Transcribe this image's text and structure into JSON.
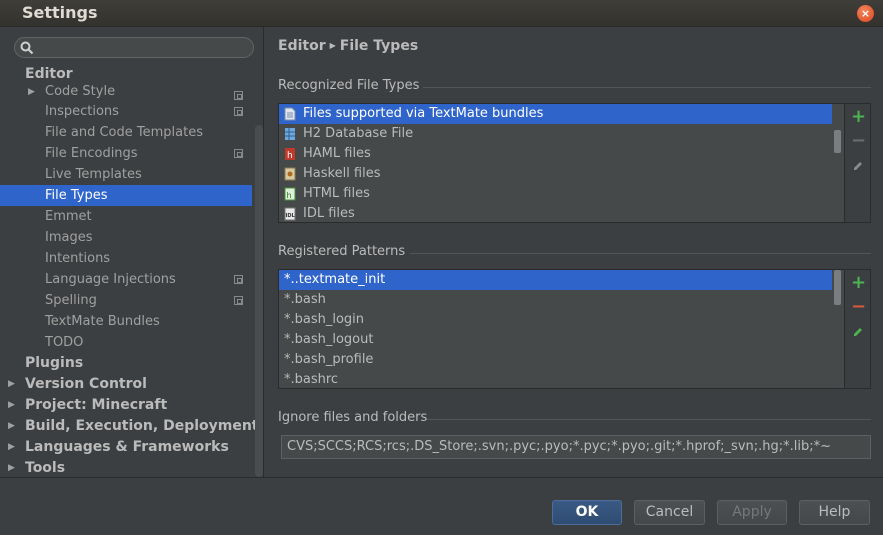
{
  "window": {
    "title": "Settings"
  },
  "sidebar": {
    "search": {
      "value": "",
      "placeholder": ""
    },
    "items": [
      {
        "label": "Editor",
        "kind": "category"
      },
      {
        "label": "Code Style",
        "kind": "sub",
        "expander": true,
        "scope": true
      },
      {
        "label": "Inspections",
        "kind": "sub",
        "scope": true
      },
      {
        "label": "File and Code Templates",
        "kind": "sub"
      },
      {
        "label": "File Encodings",
        "kind": "sub",
        "scope": true
      },
      {
        "label": "Live Templates",
        "kind": "sub"
      },
      {
        "label": "File Types",
        "kind": "sub",
        "selected": true
      },
      {
        "label": "Emmet",
        "kind": "sub"
      },
      {
        "label": "Images",
        "kind": "sub"
      },
      {
        "label": "Intentions",
        "kind": "sub"
      },
      {
        "label": "Language Injections",
        "kind": "sub",
        "scope": true
      },
      {
        "label": "Spelling",
        "kind": "sub",
        "scope": true
      },
      {
        "label": "TextMate Bundles",
        "kind": "sub"
      },
      {
        "label": "TODO",
        "kind": "sub"
      },
      {
        "label": "Plugins",
        "kind": "category"
      },
      {
        "label": "Version Control",
        "kind": "category",
        "expander": true
      },
      {
        "label": "Project: Minecraft",
        "kind": "category",
        "expander": true
      },
      {
        "label": "Build, Execution, Deployment",
        "kind": "category",
        "expander": true
      },
      {
        "label": "Languages & Frameworks",
        "kind": "category",
        "expander": true
      },
      {
        "label": "Tools",
        "kind": "category",
        "expander": true
      }
    ]
  },
  "main": {
    "breadcrumb": {
      "parent": "Editor",
      "current": "File Types"
    },
    "recognized": {
      "label": "Recognized File Types",
      "items": [
        {
          "label": "Files supported via TextMate bundles",
          "icon": "text-file-icon",
          "selected": true
        },
        {
          "label": "H2 Database File",
          "icon": "database-file-icon"
        },
        {
          "label": "HAML files",
          "icon": "haml-file-icon"
        },
        {
          "label": "Haskell files",
          "icon": "haskell-file-icon"
        },
        {
          "label": "HTML files",
          "icon": "html-file-icon"
        },
        {
          "label": "IDL files",
          "icon": "idl-file-icon"
        }
      ]
    },
    "patterns": {
      "label": "Registered Patterns",
      "items": [
        {
          "label": "*..textmate_init",
          "selected": true
        },
        {
          "label": "*.bash"
        },
        {
          "label": "*.bash_login"
        },
        {
          "label": "*.bash_logout"
        },
        {
          "label": "*.bash_profile"
        },
        {
          "label": "*.bashrc"
        }
      ]
    },
    "ignore": {
      "label": "Ignore files and folders",
      "value": "CVS;SCCS;RCS;rcs;.DS_Store;.svn;.pyc;.pyo;*.pyc;*.pyo;.git;*.hprof;_svn;.hg;*.lib;*~"
    }
  },
  "footer": {
    "ok": "OK",
    "cancel": "Cancel",
    "apply": "Apply",
    "help": "Help"
  },
  "colors": {
    "selection": "#2f65ca",
    "add": "#4bb451",
    "remove": "#d35a3e",
    "background": "#3c3f41"
  }
}
